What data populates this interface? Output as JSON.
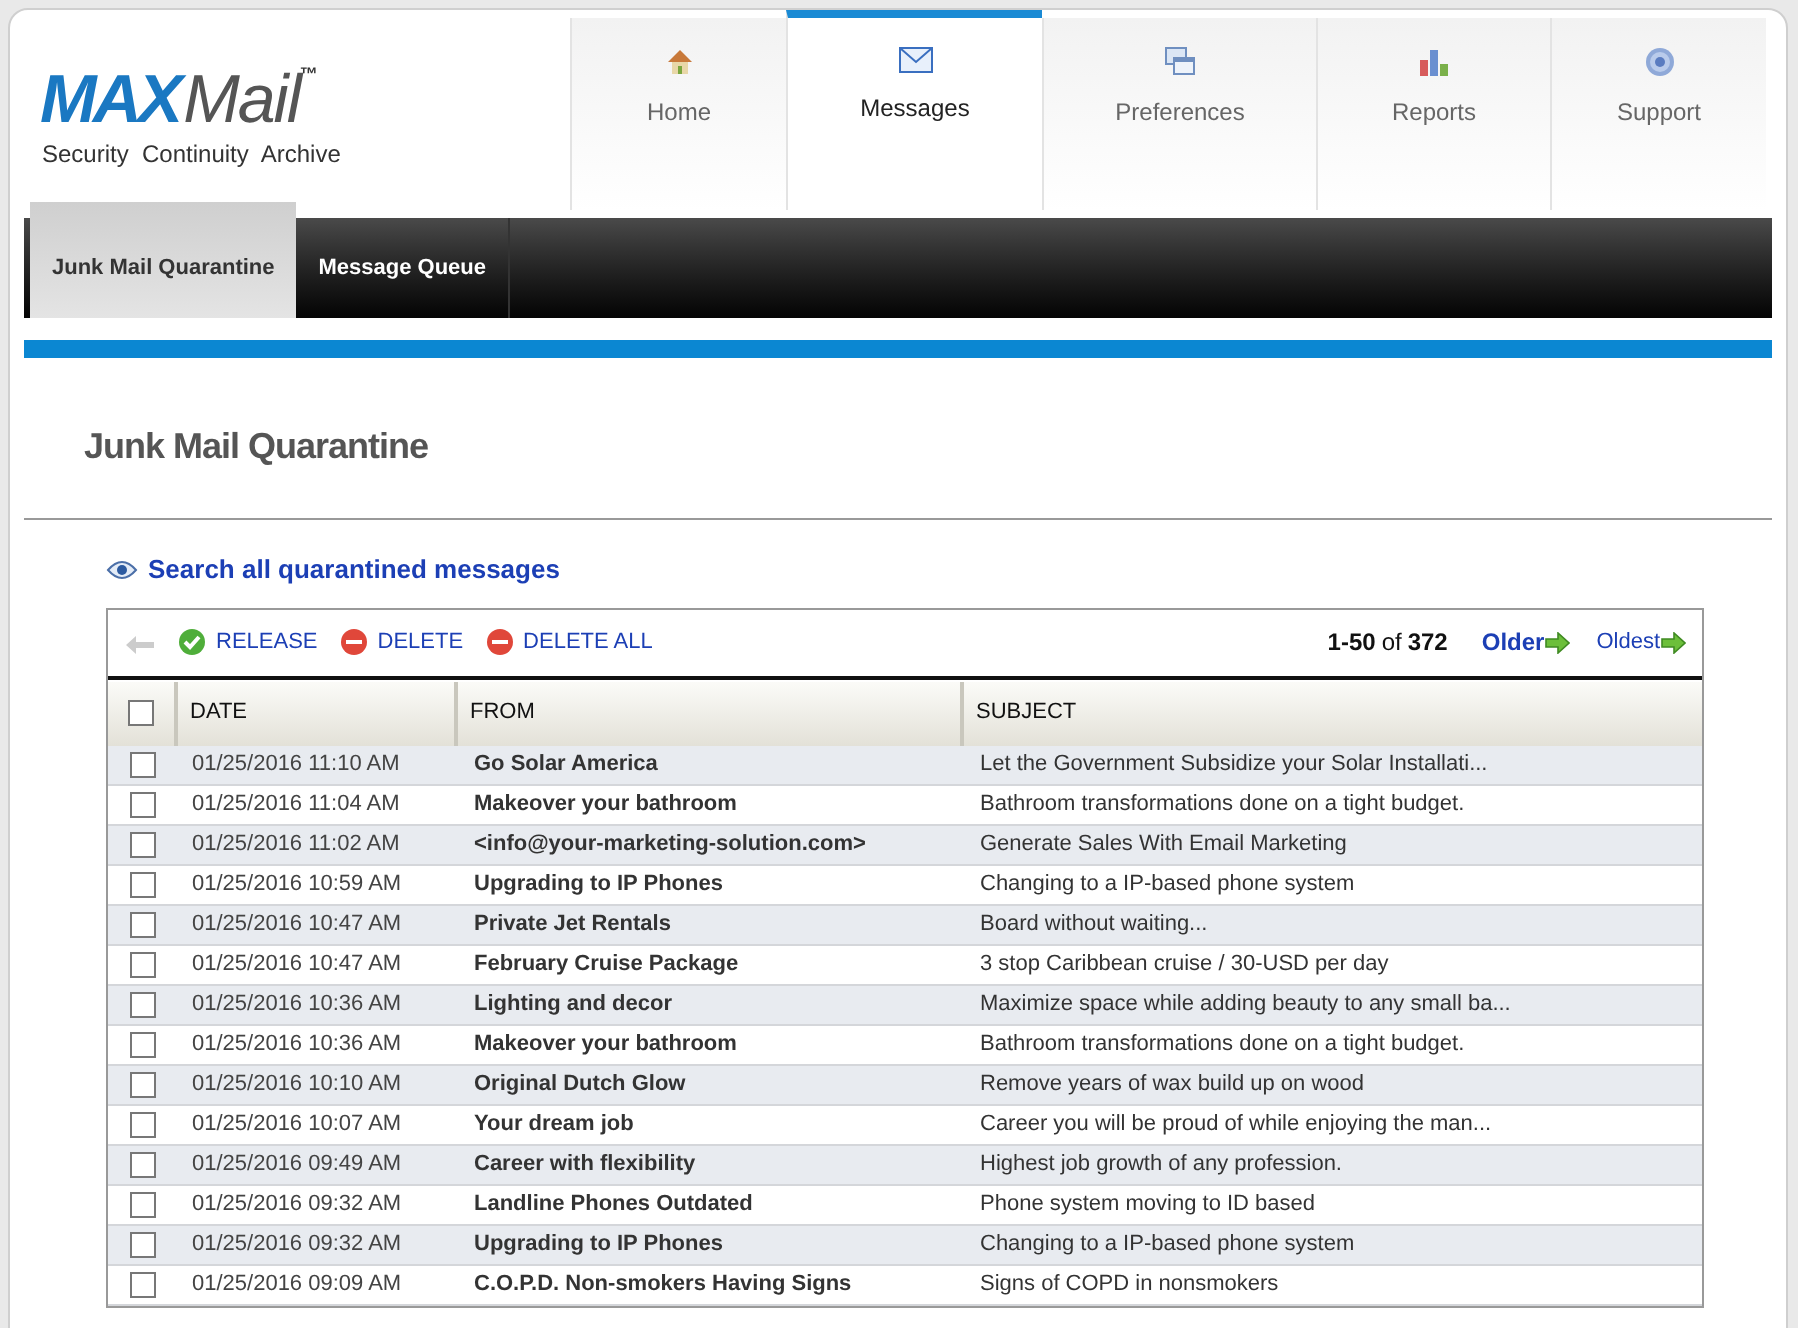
{
  "logo": {
    "brand_a": "MAX",
    "brand_b": "Mail",
    "trademark": "™",
    "tagline": "Security  Continuity  Archive"
  },
  "nav": [
    {
      "label": "Home",
      "kind": "home",
      "selected": false
    },
    {
      "label": "Messages",
      "kind": "mail",
      "selected": true
    },
    {
      "label": "Preferences",
      "kind": "windows",
      "selected": false
    },
    {
      "label": "Reports",
      "kind": "chart",
      "selected": false
    },
    {
      "label": "Support",
      "kind": "help",
      "selected": false
    }
  ],
  "subnav": [
    {
      "label": "Junk Mail Quarantine",
      "selected": true
    },
    {
      "label": "Message Queue",
      "selected": false
    }
  ],
  "page_title": "Junk Mail Quarantine",
  "search_link": "Search all quarantined messages",
  "toolbar": {
    "actions": [
      {
        "label": "RELEASE",
        "kind": "release"
      },
      {
        "label": "DELETE",
        "kind": "delete"
      },
      {
        "label": "DELETE ALL",
        "kind": "delete"
      }
    ],
    "range": "1-50",
    "of": "of",
    "total": "372",
    "older": "Older",
    "oldest": "Oldest"
  },
  "table": {
    "select_all_checked": false,
    "columns": [
      "DATE",
      "FROM",
      "SUBJECT"
    ],
    "rows": [
      {
        "checked": false,
        "date": "01/25/2016 11:10 AM",
        "from": "Go Solar America",
        "subject": "Let the Government Subsidize your Solar Installati..."
      },
      {
        "checked": false,
        "date": "01/25/2016 11:04 AM",
        "from": "Makeover your bathroom",
        "subject": "Bathroom transformations done on a tight budget."
      },
      {
        "checked": false,
        "date": "01/25/2016 11:02 AM",
        "from": "<info@your-marketing-solution.com>",
        "subject": "Generate Sales With Email Marketing"
      },
      {
        "checked": false,
        "date": "01/25/2016 10:59 AM",
        "from": "Upgrading to IP Phones",
        "subject": "Changing to a IP-based phone system"
      },
      {
        "checked": false,
        "date": "01/25/2016 10:47 AM",
        "from": "Private Jet Rentals",
        "subject": "Board without waiting..."
      },
      {
        "checked": false,
        "date": "01/25/2016 10:47 AM",
        "from": "February Cruise Package",
        "subject": "3 stop Caribbean cruise / 30-USD per day"
      },
      {
        "checked": false,
        "date": "01/25/2016 10:36 AM",
        "from": "Lighting and decor",
        "subject": "Maximize space while adding beauty to any small ba..."
      },
      {
        "checked": false,
        "date": "01/25/2016 10:36 AM",
        "from": "Makeover your bathroom",
        "subject": "Bathroom transformations done on a tight budget."
      },
      {
        "checked": false,
        "date": "01/25/2016 10:10 AM",
        "from": "Original Dutch Glow",
        "subject": "Remove years of wax build up on wood"
      },
      {
        "checked": false,
        "date": "01/25/2016 10:07 AM",
        "from": "Your dream job",
        "subject": "Career you will be proud of while enjoying the man..."
      },
      {
        "checked": false,
        "date": "01/25/2016 09:49 AM",
        "from": "Career with flexibility",
        "subject": "Highest job growth of any profession."
      },
      {
        "checked": false,
        "date": "01/25/2016 09:32 AM",
        "from": "Landline Phones Outdated",
        "subject": "Phone system moving to ID based"
      },
      {
        "checked": false,
        "date": "01/25/2016 09:32 AM",
        "from": "Upgrading to IP Phones",
        "subject": "Changing to a IP-based phone system"
      },
      {
        "checked": false,
        "date": "01/25/2016 09:09 AM",
        "from": "C.O.P.D. Non-smokers Having Signs",
        "subject": "Signs of COPD in nonsmokers"
      }
    ]
  }
}
